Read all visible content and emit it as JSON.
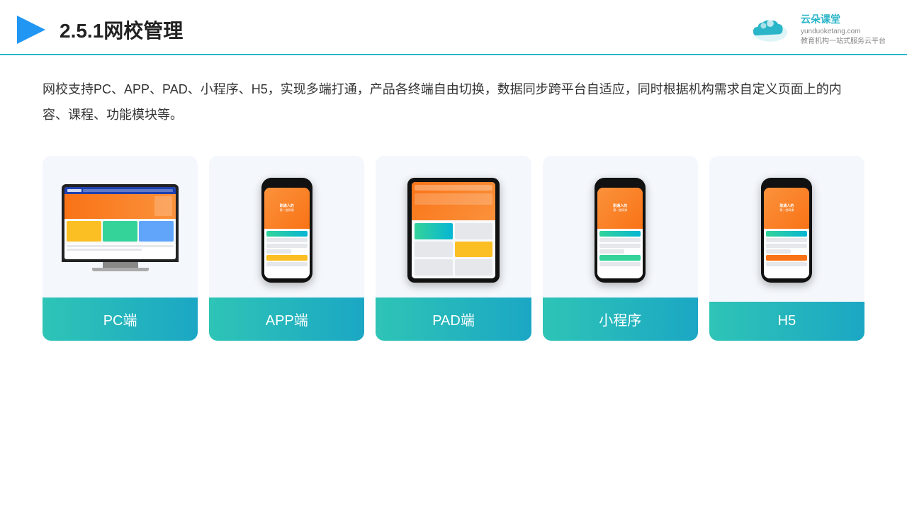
{
  "header": {
    "title": "2.5.1网校管理",
    "logo": {
      "name": "云朵课堂",
      "url": "yunduoketang.com",
      "tagline": "教育机构一站式服务云平台"
    }
  },
  "description": {
    "text": "网校支持PC、APP、PAD、小程序、H5，实现多端打通，产品各终端自由切换，数据同步跨平台自适应，同时根据机构需求自定义页面上的内容、课程、功能模块等。"
  },
  "cards": [
    {
      "id": "pc",
      "label": "PC端"
    },
    {
      "id": "app",
      "label": "APP端"
    },
    {
      "id": "pad",
      "label": "PAD端"
    },
    {
      "id": "miniapp",
      "label": "小程序"
    },
    {
      "id": "h5",
      "label": "H5"
    }
  ]
}
